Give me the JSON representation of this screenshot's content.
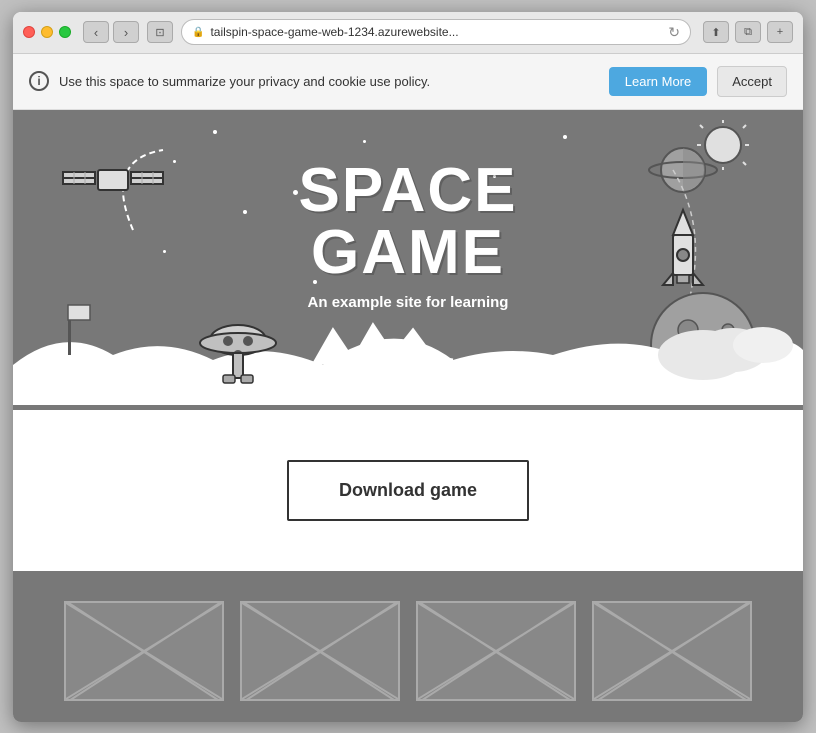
{
  "browser": {
    "url": "tailspin-space-game-web-1234.azurewebsite...",
    "nav_back": "‹",
    "nav_forward": "›",
    "window_icon": "⊡",
    "plus_icon": "+"
  },
  "cookie_banner": {
    "info_icon": "i",
    "text": "Use this space to summarize your privacy and cookie use policy.",
    "learn_more_label": "Learn More",
    "accept_label": "Accept"
  },
  "hero": {
    "title_line1": "SPACE",
    "title_line2": "GAME",
    "subtitle": "An example site for learning"
  },
  "download": {
    "button_label": "Download game"
  },
  "footer": {
    "placeholder_count": 4
  }
}
